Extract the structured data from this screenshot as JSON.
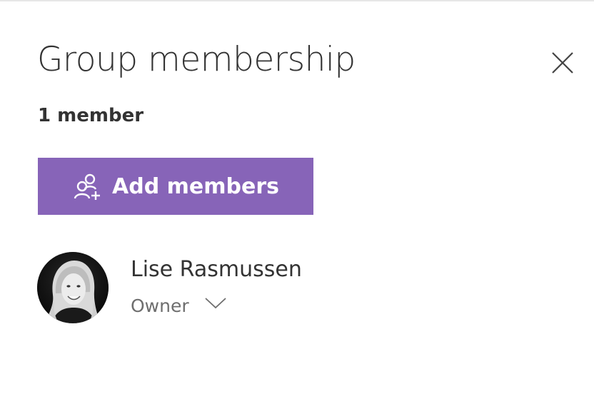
{
  "panel": {
    "title": "Group membership",
    "member_count": "1 member",
    "add_button_label": "Add members",
    "accent_color": "#8764b8"
  },
  "members": [
    {
      "name": "Lise Rasmussen",
      "role": "Owner"
    }
  ],
  "icons": {
    "close": "close-icon",
    "add_members": "add-people-icon",
    "role_dropdown": "chevron-down-icon",
    "avatar": "user-photo"
  }
}
